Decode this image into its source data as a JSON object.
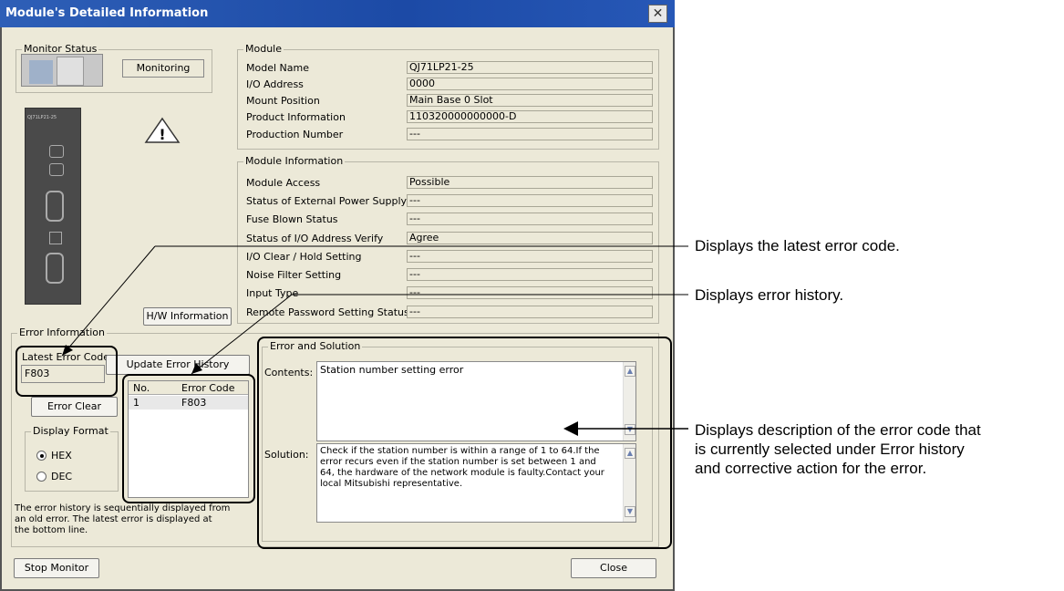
{
  "window": {
    "title": "Module's Detailed Information"
  },
  "monitor_status": {
    "legend": "Monitor Status",
    "state": "Monitoring"
  },
  "module": {
    "legend": "Module",
    "rows": [
      {
        "label": "Model Name",
        "value": "QJ71LP21-25"
      },
      {
        "label": "I/O Address",
        "value": "0000"
      },
      {
        "label": "Mount Position",
        "value": "Main Base  0 Slot"
      },
      {
        "label": "Product Information",
        "value": "110320000000000-D"
      },
      {
        "label": "Production Number",
        "value": "---"
      }
    ]
  },
  "module_information": {
    "legend": "Module Information",
    "rows": [
      {
        "label": "Module Access",
        "value": "Possible"
      },
      {
        "label": "Status of External Power Supply",
        "value": "---"
      },
      {
        "label": "Fuse Blown Status",
        "value": "---"
      },
      {
        "label": "Status of I/O Address Verify",
        "value": "Agree"
      },
      {
        "label": "I/O Clear / Hold Setting",
        "value": "---"
      },
      {
        "label": "Noise Filter Setting",
        "value": "---"
      },
      {
        "label": "Input Type",
        "value": "---"
      },
      {
        "label": "Remote Password Setting Status",
        "value": "---"
      }
    ]
  },
  "hw_button": "H/W Information",
  "error_information": {
    "legend": "Error Information",
    "latest_label": "Latest Error Code",
    "latest_value": "F803",
    "update_button": "Update Error History",
    "clear_button": "Error Clear",
    "history_headers": [
      "No.",
      "Error Code"
    ],
    "history_rows": [
      {
        "no": "1",
        "code": "F803"
      }
    ],
    "display_format": {
      "legend": "Display Format",
      "options": [
        {
          "label": "HEX",
          "selected": true
        },
        {
          "label": "DEC",
          "selected": false
        }
      ]
    },
    "note": [
      "The error history is sequentially displayed from",
      "an old error. The latest error is displayed at",
      "the bottom line."
    ]
  },
  "error_and_solution": {
    "legend": "Error and Solution",
    "contents_label": "Contents:",
    "contents": "Station number setting error",
    "solution_label": "Solution:",
    "solution": [
      "Check if the station number is within a range of 1 to 64.If the",
      "error recurs even if the station number is set between 1 and",
      "64, the hardware of the network module is faulty.Contact your",
      "local Mitsubishi representative."
    ]
  },
  "footer": {
    "stop_button": "Stop Monitor",
    "close_button": "Close"
  },
  "callouts": {
    "latest": "Displays the latest error code.",
    "history": "Displays error history.",
    "description": [
      "Displays description of the error code that",
      "is currently selected under Error history",
      "and corrective action for the error."
    ]
  }
}
